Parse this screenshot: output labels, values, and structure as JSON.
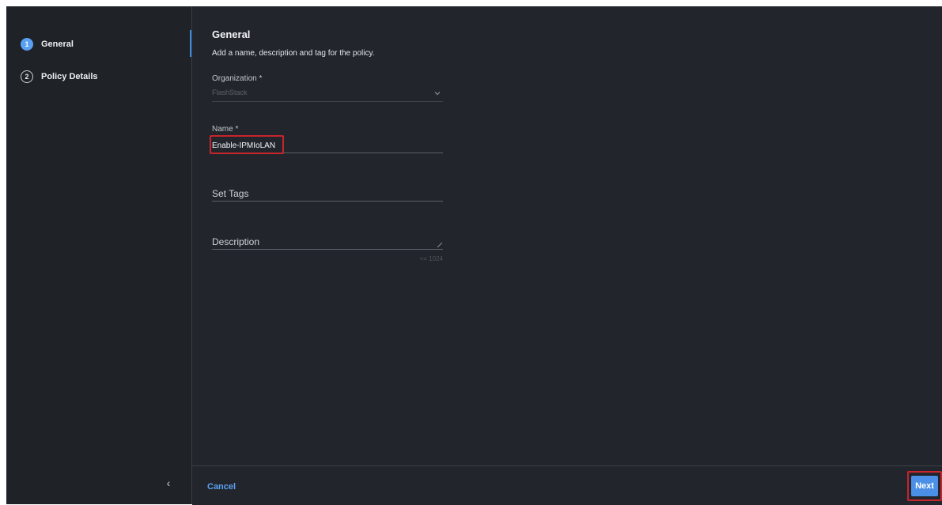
{
  "wizard": {
    "steps": [
      {
        "number": "1",
        "label": "General",
        "state": "active"
      },
      {
        "number": "2",
        "label": "Policy Details",
        "state": "inactive"
      }
    ],
    "collapse_glyph": "‹"
  },
  "form": {
    "title": "General",
    "subtitle": "Add a name, description and tag for the policy.",
    "organization": {
      "label": "Organization *",
      "value": "FlashStack",
      "icon": "chevron-down-icon"
    },
    "name": {
      "label": "Name *",
      "value": "Enable-IPMIoLAN"
    },
    "tags": {
      "placeholder": "Set Tags"
    },
    "description": {
      "placeholder": "Description",
      "counter": "<= 1024"
    }
  },
  "footer": {
    "cancel_label": "Cancel",
    "next_label": "Next"
  },
  "colors": {
    "accent": "#5aa0f2",
    "highlight": "#c8242b",
    "background": "#22262c"
  }
}
